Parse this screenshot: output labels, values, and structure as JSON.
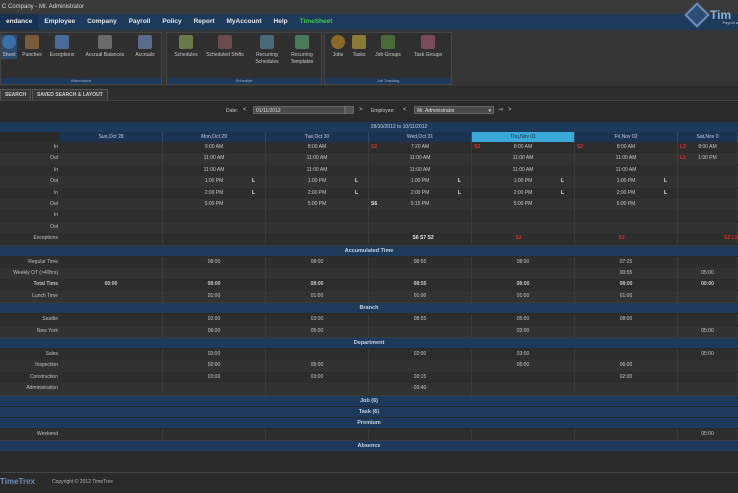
{
  "window": {
    "title": "C Company - Mr. Administrator"
  },
  "menu": [
    {
      "label": "endance",
      "active": true
    },
    {
      "label": "Employee"
    },
    {
      "label": "Company"
    },
    {
      "label": "Payroll"
    },
    {
      "label": "Policy"
    },
    {
      "label": "Report"
    },
    {
      "label": "MyAccount"
    },
    {
      "label": "Help"
    },
    {
      "label": "TimeSheet",
      "green": true
    }
  ],
  "logo": {
    "text": "Tim",
    "sub": "Payroll a"
  },
  "toolbar": {
    "attendance_label": "Attendance",
    "schedule_label": "Schedule",
    "job_tracking_label": "Job Tracking",
    "buttons": {
      "timesheet": "Sheet",
      "punches": "Punches",
      "exceptions": "Exceptions",
      "accrual_balances": "Accrual Balances",
      "accruals": "Accruals",
      "schedules": "Schedules",
      "scheduled_shifts": "Scheduled Shifts",
      "recurring_schedules_1": "Recurring",
      "recurring_schedules_2": "Schedules",
      "recurring_templates_1": "Recurring",
      "recurring_templates_2": "Templates",
      "jobs": "Jobs",
      "tasks": "Tasks",
      "job_groups": "Job Groups",
      "task_groups": "Task Groups"
    }
  },
  "search_tabs": {
    "search": "SEARCH",
    "saved": "SAVED SEARCH & LAYOUT"
  },
  "filter": {
    "date_label": "Date:",
    "date_value": "01/11/2012",
    "employee_label": "Employee:",
    "employee_value": "Mr. Administrator",
    "prev": "<",
    "next": ">",
    "emp_prev": "<",
    "emp_next": ">"
  },
  "grid": {
    "date_range": "28/10/2012 to 10/11/2012",
    "days": [
      {
        "label": "Sun,Oct 28"
      },
      {
        "label": "Mon,Oct 29"
      },
      {
        "label": "Tue,Oct 30"
      },
      {
        "label": "Wed,Oct 31"
      },
      {
        "label": "Thu,Nov 01",
        "today": true
      },
      {
        "label": "Fri,Nov 02"
      },
      {
        "label": "Sat,Nov 0"
      }
    ],
    "punch_rows": [
      {
        "label": "In",
        "cells": [
          "",
          "9:00 AM",
          "8:00 AM",
          "7:20 AM",
          "8:00 AM",
          "8:00 AM",
          "8:00 AM"
        ],
        "flags": [
          [
            "",
            ""
          ],
          [
            "",
            ""
          ],
          [
            "",
            ""
          ],
          [
            "S2",
            "red-left"
          ],
          [
            "S2",
            "red-left"
          ],
          [
            "S2",
            "red-left"
          ],
          [
            "L3",
            "red-left"
          ]
        ]
      },
      {
        "label": "Out",
        "cells": [
          "",
          "11:00 AM",
          "11:00 AM",
          "11:00 AM",
          "11:00 AM",
          "11:00 AM",
          "1:00 PM"
        ],
        "flags": [
          [
            "",
            ""
          ],
          [
            "",
            ""
          ],
          [
            "",
            ""
          ],
          [
            "",
            ""
          ],
          [
            "",
            ""
          ],
          [
            "",
            ""
          ],
          [
            "L3",
            "red-left"
          ]
        ]
      },
      {
        "label": "In",
        "cells": [
          "",
          "11:00 AM",
          "11:00 AM",
          "11:00 AM",
          "11:00 AM",
          "11:00 AM",
          ""
        ],
        "flags": []
      },
      {
        "label": "Out",
        "cells": [
          "",
          "1:00 PM",
          "1:00 PM",
          "1:00 PM",
          "1:00 PM",
          "1:00 PM",
          ""
        ],
        "flags": [
          [
            "",
            ""
          ],
          [
            "L",
            "blk-right"
          ],
          [
            "L",
            "blk-right"
          ],
          [
            "L",
            "blk-right"
          ],
          [
            "L",
            "blk-right"
          ],
          [
            "L",
            "blk-right"
          ],
          [
            "",
            ""
          ]
        ]
      },
      {
        "label": "In",
        "cells": [
          "",
          "2:00 PM",
          "2:00 PM",
          "2:00 PM",
          "2:00 PM",
          "2:00 PM",
          ""
        ],
        "flags": [
          [
            "",
            ""
          ],
          [
            "L",
            "blk-right"
          ],
          [
            "L",
            "blk-right"
          ],
          [
            "L",
            "blk-right"
          ],
          [
            "L",
            "blk-right"
          ],
          [
            "L",
            "blk-right"
          ],
          [
            "",
            ""
          ]
        ]
      },
      {
        "label": "Out",
        "cells": [
          "",
          "5:00 PM",
          "5:00 PM",
          "5:15 PM",
          "5:00 PM",
          "5:00 PM",
          ""
        ],
        "flags": [
          [
            "",
            ""
          ],
          [
            "",
            ""
          ],
          [
            "",
            ""
          ],
          [
            "S6",
            "blk-left"
          ],
          [
            "",
            ""
          ],
          [
            "",
            ""
          ],
          [
            "",
            ""
          ]
        ]
      },
      {
        "label": "In",
        "cells": [
          "",
          "",
          "",
          "",
          "",
          "",
          ""
        ],
        "flags": []
      },
      {
        "label": "Out",
        "cells": [
          "",
          "",
          "",
          "",
          "",
          "",
          ""
        ],
        "flags": []
      },
      {
        "label": "Exceptions",
        "cells": [
          "",
          "",
          "",
          "",
          "",
          "",
          ""
        ],
        "flags": [
          [
            "",
            ""
          ],
          [
            "",
            ""
          ],
          [
            "",
            ""
          ],
          [
            "S6 S7 S2",
            "mixed-center"
          ],
          [
            "S2",
            "red-center"
          ],
          [
            "S2",
            "red-center"
          ],
          [
            "S2 L3",
            "red-right"
          ]
        ]
      }
    ],
    "sections": {
      "accumulated": "Accumulated Time",
      "branch": "Branch",
      "department": "Department",
      "job": "Job (6)",
      "task": "Task (6)",
      "premium": "Premium",
      "absence": "Absence"
    },
    "accumulated_rows": [
      {
        "label": "Regular Time",
        "cells": [
          "",
          "08:00",
          "08:00",
          "08:55",
          "08:00",
          "07:25",
          ""
        ]
      },
      {
        "label": "Weekly OT (>40hrs)",
        "cells": [
          "",
          "",
          "",
          "",
          "",
          "00:55",
          "05:00"
        ]
      },
      {
        "label": "Total Time",
        "bold": true,
        "cells": [
          "00:00",
          "08:00",
          "08:00",
          "08:55",
          "08:00",
          "08:00",
          "00:00"
        ]
      },
      {
        "label": "Lunch Time",
        "cells": [
          "",
          "01:00",
          "01:00",
          "01:00",
          "01:00",
          "01:00",
          ""
        ]
      }
    ],
    "branch_rows": [
      {
        "label": "Seattle",
        "cells": [
          "",
          "02:00",
          "03:00",
          "08:55",
          "05:00",
          "08:00",
          ""
        ]
      },
      {
        "label": "New York",
        "cells": [
          "",
          "06:00",
          "05:00",
          "",
          "03:00",
          "",
          "05:00"
        ]
      }
    ],
    "department_rows": [
      {
        "label": "Sales",
        "cells": [
          "",
          "03:00",
          "",
          "02:00",
          "03:00",
          "",
          "05:00"
        ]
      },
      {
        "label": "Inspection",
        "cells": [
          "",
          "02:00",
          "05:00",
          "",
          "05:00",
          "06:00",
          ""
        ]
      },
      {
        "label": "Construction",
        "cells": [
          "",
          "03:00",
          "03:00",
          "03:15",
          "",
          "02:00",
          ""
        ]
      },
      {
        "label": "Administration",
        "cells": [
          "",
          "",
          "",
          "03:40",
          "",
          "",
          ""
        ]
      }
    ],
    "premium_rows": [
      {
        "label": "Weekend",
        "cells": [
          "",
          "",
          "",
          "",
          "",
          "",
          "05:00"
        ]
      }
    ]
  },
  "footer": {
    "logo": "TimeTrex",
    "copyright": "Copyright © 2012 TimeTrex"
  }
}
